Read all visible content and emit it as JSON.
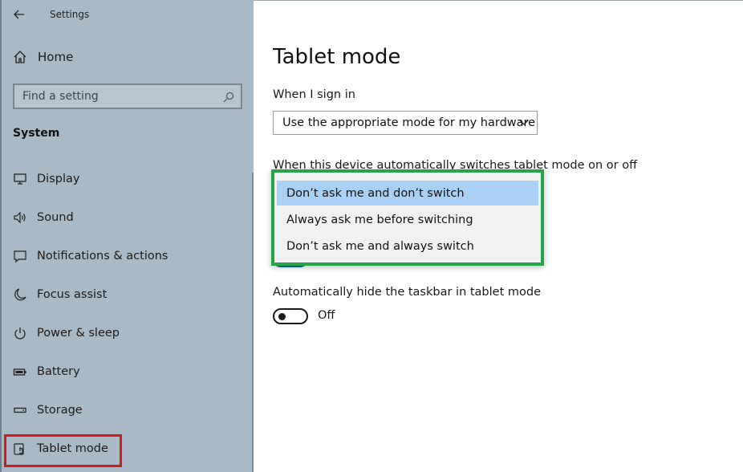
{
  "window": {
    "title": "Settings"
  },
  "sidebar": {
    "home_label": "Home",
    "search_placeholder": "Find a setting",
    "group_label": "System",
    "items": [
      {
        "label": "Display",
        "icon": "display-icon"
      },
      {
        "label": "Sound",
        "icon": "speaker-icon"
      },
      {
        "label": "Notifications & actions",
        "icon": "notification-icon"
      },
      {
        "label": "Focus assist",
        "icon": "moon-icon"
      },
      {
        "label": "Power & sleep",
        "icon": "power-icon"
      },
      {
        "label": "Battery",
        "icon": "battery-icon"
      },
      {
        "label": "Storage",
        "icon": "storage-icon"
      },
      {
        "label": "Tablet mode",
        "icon": "tablet-mode-icon",
        "selected": true
      }
    ]
  },
  "main": {
    "title": "Tablet mode",
    "signin_label": "When I sign in",
    "signin_value": "Use the appropriate mode for my hardware",
    "switch_label": "When this device automatically switches tablet mode on or off",
    "switch_options": [
      {
        "label": "Don’t ask me and don’t switch",
        "selected": true
      },
      {
        "label": "Always ask me before switching",
        "selected": false
      },
      {
        "label": "Don’t ask me and always switch",
        "selected": false
      }
    ],
    "taskbar_label": "Automatically hide the taskbar in tablet mode",
    "taskbar_toggle_state": "Off"
  },
  "colors": {
    "sidebar_bg": "#a9b9c5",
    "accent": "#0063b1",
    "dropdown_selected": "#a8d1f5",
    "highlight_green": "#22a648",
    "highlight_red": "#d7161c"
  }
}
